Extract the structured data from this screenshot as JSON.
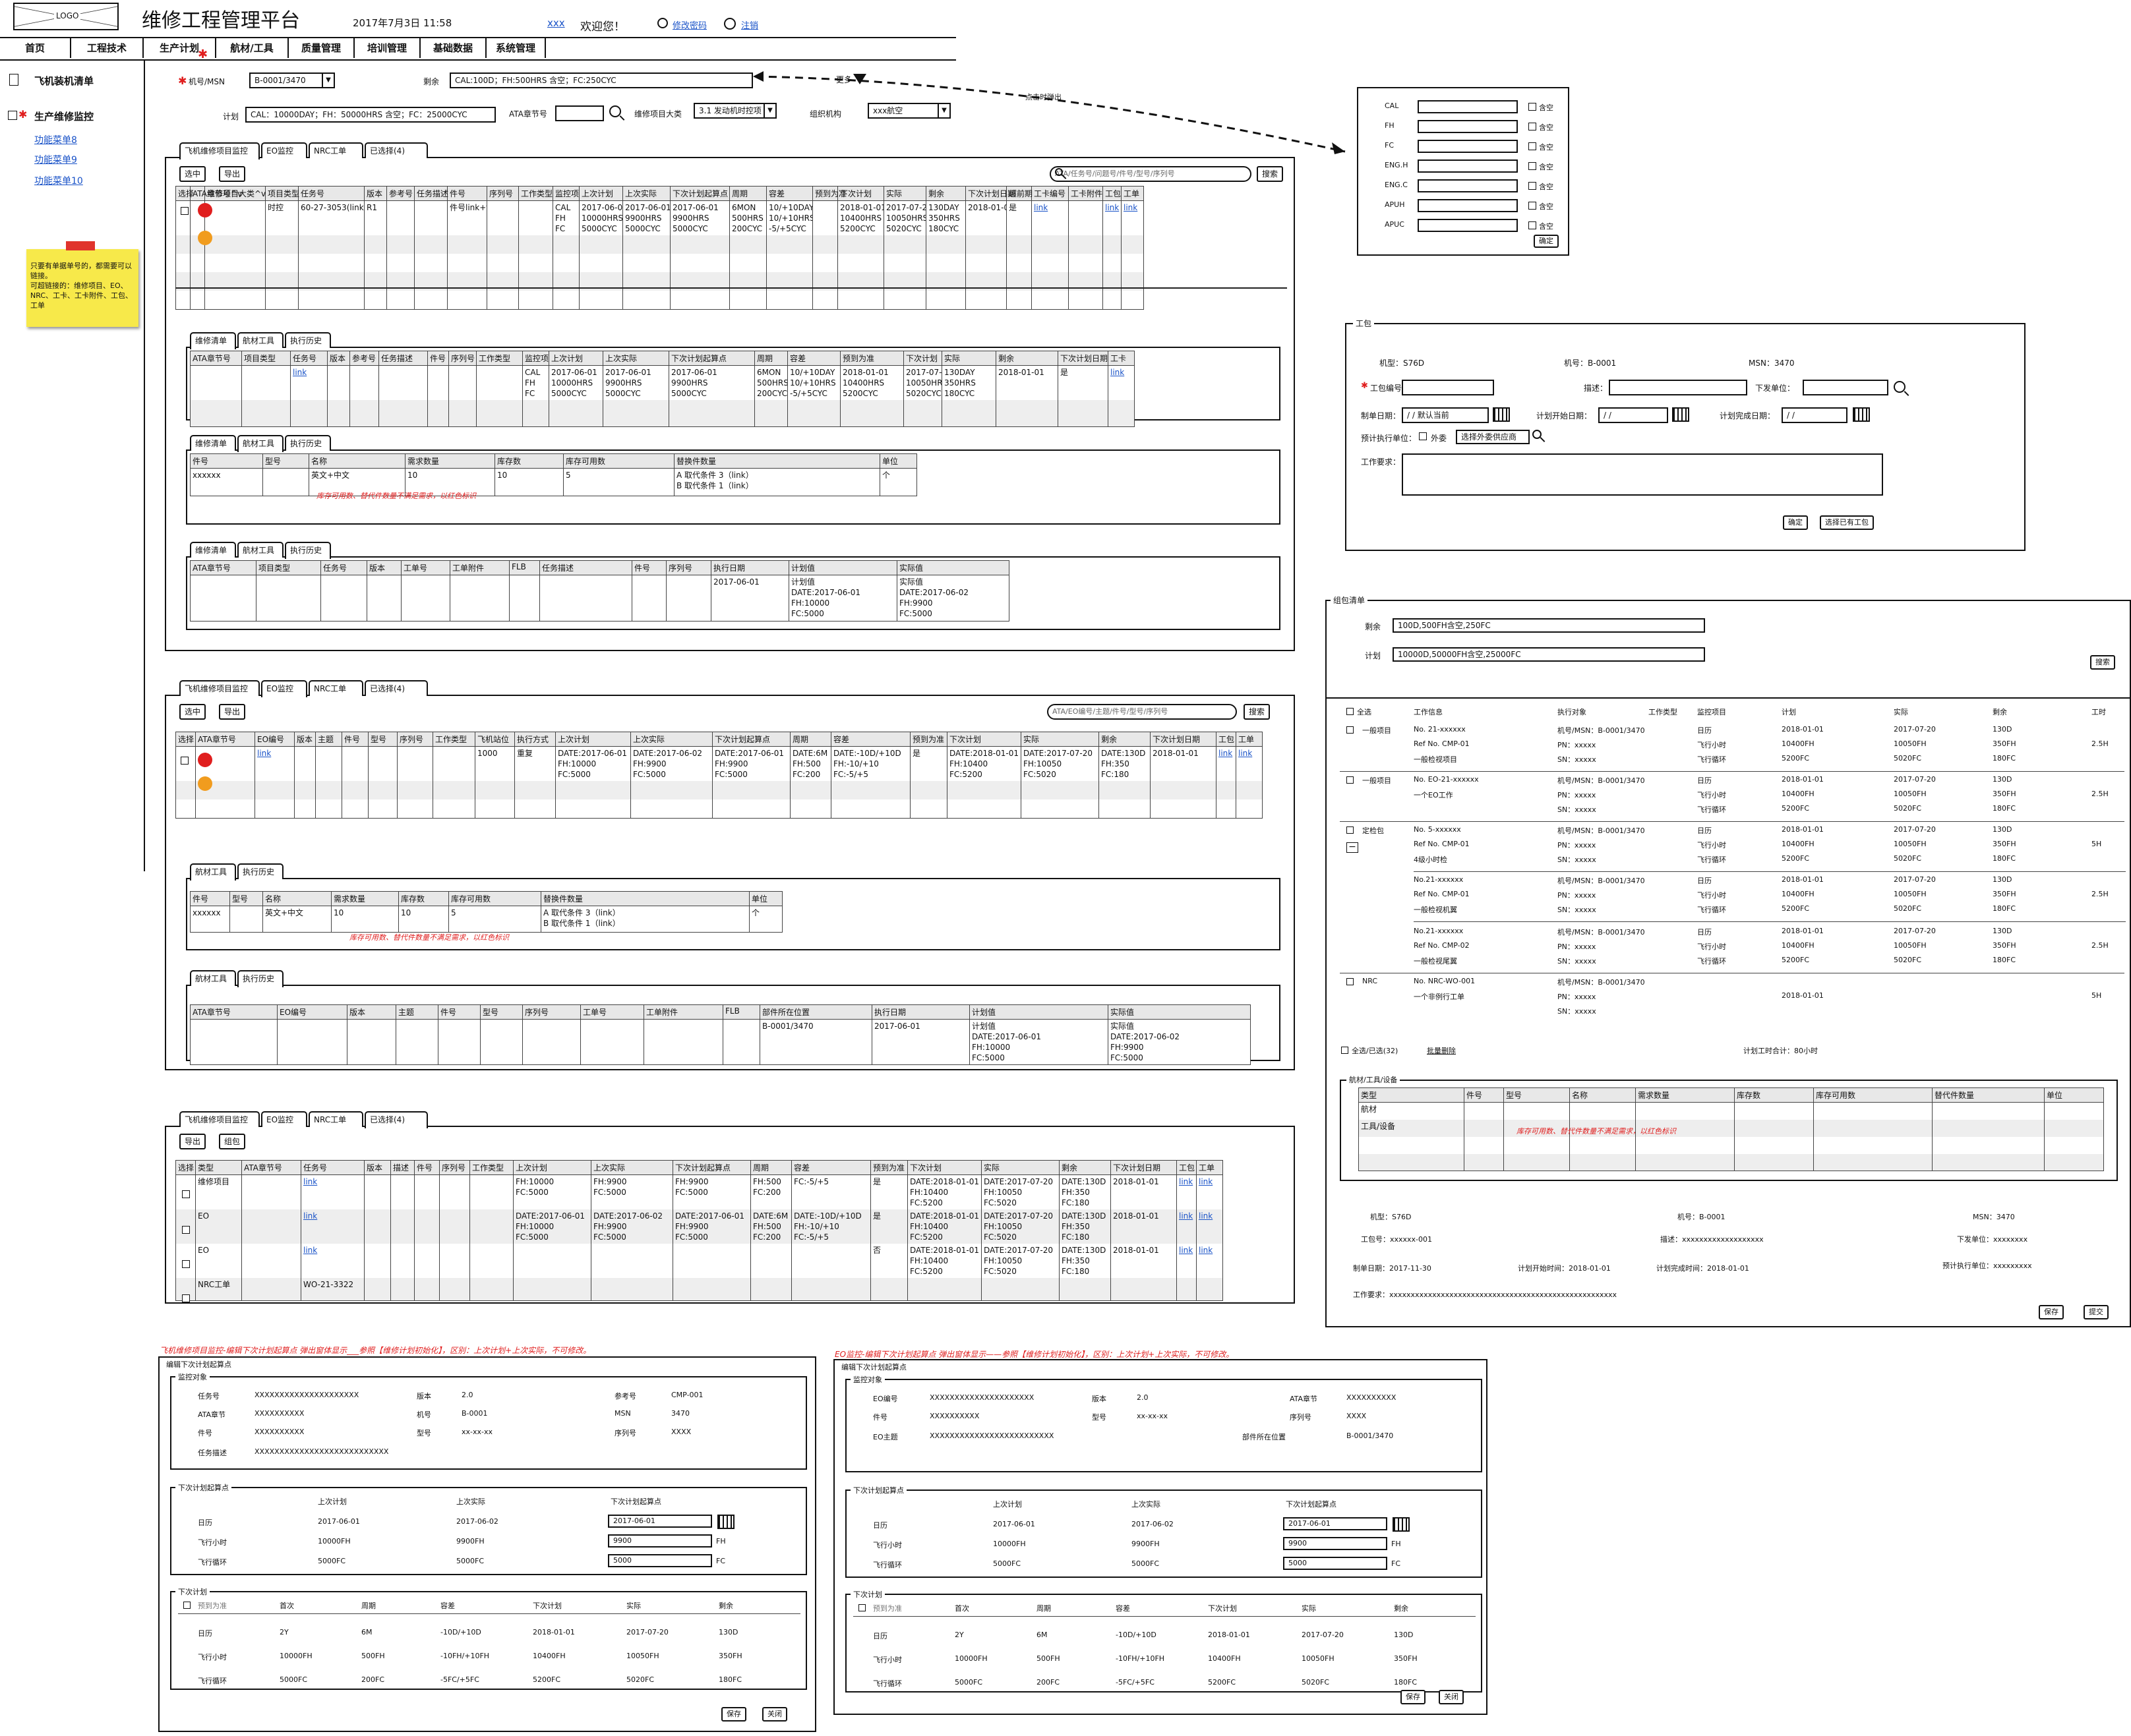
{
  "header": {
    "logo": "LOGO",
    "title": "维修工程管理平台",
    "date": "2017年7月3日 11:58",
    "user": "xxx",
    "welcome": "欢迎您！",
    "change_pwd": "修改密码",
    "logout": "注销"
  },
  "nav": [
    "首页",
    "工程技术",
    "生产计划",
    "航材/工具",
    "质量管理",
    "培训管理",
    "基础数据",
    "系统管理"
  ],
  "sidebar": {
    "item1": "飞机装机清单",
    "item2": "生产维修监控",
    "sub": [
      "功能菜单8",
      "功能菜单9",
      "功能菜单10"
    ]
  },
  "note": "只要有单据单号的，都需要可以链接。\n可超链接的：维修项目、EO、NRC、工卡、工卡附件、工包、工单",
  "filters": {
    "msn_label": "机号/MSN",
    "msn_value": "B-0001/3470",
    "remain_label": "剩余",
    "remain_value": "CAL:100D；FH:500HRS 含空；FC:250CYC",
    "more": "更多",
    "click_popup": "点击时弹出",
    "plan_label": "计划",
    "plan_value": "CAL：10000DAY；FH：50000HRS 含空；FC：25000CYC",
    "ata_label": "ATA章节号",
    "cat_label": "维修项目大类",
    "cat_value": "3.1 发动机时控项",
    "org_label": "组织机构",
    "org_value": "xxx航空"
  },
  "popup": {
    "rows": [
      {
        "label": "CAL",
        "suffix": "含空"
      },
      {
        "label": "FH",
        "suffix": "含空"
      },
      {
        "label": "FC",
        "suffix": "含空"
      },
      {
        "label": "ENG.H",
        "suffix": "含空"
      },
      {
        "label": "ENG.C",
        "suffix": "含空"
      },
      {
        "label": "APUH",
        "suffix": "含空"
      },
      {
        "label": "APUC",
        "suffix": "含空"
      }
    ],
    "ok": "确定"
  },
  "tabs1": [
    "飞机维修项目监控",
    "EO监控",
    "NRC工单",
    "已选择(4)"
  ],
  "tabs_sub_a": [
    "维修清单",
    "航材工具",
    "执行历史"
  ],
  "tabs_sub_eo": [
    "航材工具",
    "执行历史"
  ],
  "panel1": {
    "btn_select": "选中",
    "btn_export": "导出",
    "search_ph": "ATA/任务号/问题号/件号/型号/序列号",
    "search_btn": "搜索",
    "cols": [
      "选择",
      "ATA章节号^v",
      "维修项目大类^v",
      "项目类型",
      "任务号",
      "版本",
      "参考号",
      "任务描述",
      "件号",
      "序列号",
      "工作类型",
      "监控项",
      "上次计划",
      "上次实际",
      "下次计划起算点",
      "周期",
      "容差",
      "预到为准",
      "下次计划",
      "实际",
      "剩余",
      "下次计划日期",
      "超前期",
      "工卡编号",
      "工卡附件",
      "工包",
      "工单"
    ],
    "row": [
      "",
      "",
      "",
      "时控",
      "60-27-3053(link)",
      "R1",
      "",
      "",
      "件号link+title",
      "",
      "",
      "CAL\nFH\nFC",
      "2017-06-01\n10000HRS\n5000CYC",
      "2017-06-01\n9900HRS\n5000CYC",
      "2017-06-01\n9900HRS\n5000CYC",
      "6MON\n500HRS\n200CYC",
      "10/+10DAY\n10/+10HRS\n-5/+5CYC",
      "",
      "2018-01-01\n10400HRS\n5200CYC",
      "2017-07-20\n10050HRS\n5020CYC",
      "130DAY\n350HRS\n180CYC",
      "2018-01-01",
      "是",
      "link",
      "",
      "link",
      "link"
    ]
  },
  "sub1": {
    "cols": [
      "ATA章节号",
      "项目类型",
      "任务号",
      "版本",
      "参考号",
      "任务描述",
      "件号",
      "序列号",
      "工作类型",
      "监控项",
      "上次计划",
      "上次实际",
      "下次计划起算点",
      "周期",
      "容差",
      "预到为准",
      "下次计划",
      "实际",
      "剩余",
      "下次计划日期",
      "工卡"
    ],
    "row": [
      "",
      "",
      "link",
      "",
      "",
      "",
      "",
      "",
      "",
      "CAL\nFH\nFC",
      "2017-06-01\n10000HRS\n5000CYC",
      "2017-06-01\n9900HRS\n5000CYC",
      "2017-06-01\n9900HRS\n5000CYC",
      "6MON\n500HRS\n200CYC",
      "10/+10DAY\n10/+10HRS\n-5/+5CYC",
      "2018-01-01\n10400HRS\n5200CYC",
      "2017-07-20\n10050HRS\n5020CYC",
      "130DAY\n350HRS\n180CYC",
      "2018-01-01",
      "是",
      "link"
    ]
  },
  "sub2": {
    "cols": [
      "件号",
      "型号",
      "名称",
      "需求数量",
      "库存数",
      "库存可用数",
      "替换件数量",
      "单位"
    ],
    "row": [
      "xxxxxx",
      "",
      "英文+中文",
      "10",
      "10",
      "5",
      "A 取代条件 3（link）\nB 取代条件 1（link）",
      "个"
    ],
    "note": "库存可用数、替代件数量不满足需求，以红色标识"
  },
  "sub3": {
    "cols": [
      "ATA章节号",
      "项目类型",
      "任务号",
      "版本",
      "工单号",
      "工单附件",
      "FLB",
      "任务描述",
      "件号",
      "序列号",
      "执行日期",
      "计划值",
      "实际值"
    ],
    "row": [
      "",
      "",
      "",
      "",
      "",
      "",
      "",
      "",
      "",
      "",
      "2017-06-01",
      "计划值\nDATE:2017-06-01\nFH:10000\nFC:5000",
      "实际值\nDATE:2017-06-02\nFH:9900\nFC:5000"
    ]
  },
  "panel2": {
    "btn_select": "选中",
    "btn_export": "导出",
    "search_ph": "ATA/EO编号/主题/件号/型号/序列号",
    "search_btn": "搜索",
    "cols": [
      "选择",
      "ATA章节号",
      "EO编号",
      "版本",
      "主题",
      "件号",
      "型号",
      "序列号",
      "工作类型",
      "飞机站位",
      "执行方式",
      "上次计划",
      "上次实际",
      "下次计划起算点",
      "周期",
      "容差",
      "预到为准",
      "下次计划",
      "实际",
      "剩余",
      "下次计划日期",
      "工包",
      "工单"
    ],
    "row": [
      "",
      "",
      "link",
      "",
      "",
      "",
      "",
      "",
      "",
      "1000",
      "重复",
      "DATE:2017-06-01\nFH:10000\nFC:5000",
      "DATE:2017-06-02\nFH:9900\nFC:5000",
      "DATE:2017-06-01\nFH:9900\nFC:5000",
      "DATE:6M\nFH:500\nFC:200",
      "DATE:-10D/+10D\nFH:-10/+10\nFC:-5/+5",
      "是",
      "DATE:2018-01-01\nFH:10400\nFC:5200",
      "DATE:2017-07-20\nFH:10050\nFC:5020",
      "DATE:130D\nFH:350\nFC:180",
      "2018-01-01",
      "link",
      "link"
    ]
  },
  "eo_sub2": {
    "cols": [
      "件号",
      "型号",
      "名称",
      "需求数量",
      "库存数",
      "库存可用数",
      "替换件数量",
      "单位"
    ],
    "row": [
      "xxxxxx",
      "",
      "英文+中文",
      "10",
      "10",
      "5",
      "A 取代条件 3（link）\nB 取代条件 1（link）",
      "个"
    ],
    "note": "库存可用数、替代件数量不满足需求，以红色标识"
  },
  "eo_sub3": {
    "cols": [
      "ATA章节号",
      "EO编号",
      "版本",
      "主题",
      "件号",
      "型号",
      "序列号",
      "工单号",
      "工单附件",
      "FLB",
      "部件所在位置",
      "执行日期",
      "计划值",
      "实际值"
    ],
    "row": [
      "",
      "",
      "",
      "",
      "",
      "",
      "",
      "",
      "",
      "",
      "B-0001/3470",
      "2017-06-01",
      "计划值\nDATE:2017-06-01\nFH:10000\nFC:5000",
      "实际值\nDATE:2017-06-02\nFH:9900\nFC:5000"
    ]
  },
  "panel3": {
    "btn_export": "导出",
    "btn_group": "组包",
    "cols": [
      "选择",
      "类型",
      "ATA章节号",
      "任务号",
      "版本",
      "描述",
      "件号",
      "序列号",
      "工作类型",
      "上次计划",
      "上次实际",
      "下次计划起算点",
      "周期",
      "容差",
      "预到为准",
      "下次计划",
      "实际",
      "剩余",
      "下次计划日期",
      "工包",
      "工单"
    ],
    "rows": [
      [
        "",
        "维修项目",
        "",
        "link",
        "",
        "",
        "",
        "",
        "",
        "FH:10000\nFC:5000",
        "FH:9900\nFC:5000",
        "FH:9900\nFC:5000",
        "FH:500\nFC:200",
        "FC:-5/+5",
        "是",
        "DATE:2018-01-01\nFH:10400\nFC:5200",
        "DATE:2017-07-20\nFH:10050\nFC:5020",
        "DATE:130D\nFH:350\nFC:180",
        "2018-01-01",
        "link",
        "link"
      ],
      [
        "",
        "EO",
        "",
        "link",
        "",
        "",
        "",
        "",
        "",
        "DATE:2017-06-01\nFH:10000\nFC:5000",
        "DATE:2017-06-02\nFH:9900\nFC:5000",
        "DATE:2017-06-01\nFH:9900\nFC:5000",
        "DATE:6M\nFH:500\nFC:200",
        "DATE:-10D/+10D\nFH:-10/+10\nFC:-5/+5",
        "是",
        "DATE:2018-01-01\nFH:10400\nFC:5200",
        "DATE:2017-07-20\nFH:10050\nFC:5020",
        "DATE:130D\nFH:350\nFC:180",
        "2018-01-01",
        "link",
        "link"
      ],
      [
        "",
        "EO",
        "",
        "link",
        "",
        "",
        "",
        "",
        "",
        "",
        "",
        "",
        "",
        "",
        "否",
        "DATE:2018-01-01\nFH:10400\nFC:5200",
        "DATE:2017-07-20\nFH:10050\nFC:5020",
        "DATE:130D\nFH:350\nFC:180",
        "2018-01-01",
        "link",
        "link"
      ],
      [
        "",
        "NRC工单",
        "",
        "WO-21-3322",
        "",
        "",
        "",
        "",
        "",
        "",
        "",
        "",
        "",
        "",
        "",
        "",
        "",
        "",
        "",
        "",
        ""
      ]
    ]
  },
  "workpack": {
    "title": "工包",
    "model": "机型：S76D",
    "reg": "机号：B-0001",
    "msn": "MSN：3470",
    "wp_no": "工包编号：",
    "desc": "描述：",
    "unit": "下发单位：",
    "plan_date": "制单日期：",
    "plan_date_val": "/ /  默认当前",
    "start": "计划开始日期：",
    "start_val": "/ /",
    "end": "计划完成日期：",
    "end_val": "/ /",
    "exec_unit": "预计执行单位：",
    "outsource": "外委",
    "select_vendor": "选择外委供应商",
    "req": "工作要求：",
    "confirm": "确定",
    "choose_existing": "选择已有工包"
  },
  "group": {
    "title": "组包清单",
    "remain_label": "剩余",
    "remain_val": "100D,500FH含空,250FC",
    "plan_label": "计划",
    "plan_val": "10000D,50000FH含空,25000FC",
    "search": "搜索",
    "cols": [
      "全选",
      "工作信息",
      "执行对象",
      "工作类型",
      "监控项目",
      "计划",
      "实际",
      "剩余",
      "工时"
    ],
    "items": [
      {
        "type": "一般项目",
        "info": [
          "No. 21-xxxxxx",
          "Ref No. CMP-01",
          "一般检视项目"
        ],
        "obj": [
          "机号/MSN：B-0001/3470",
          "PN：xxxxx",
          "SN：xxxxx"
        ],
        "mon": [
          "日历",
          "飞行小时",
          "飞行循环"
        ],
        "plan": [
          "2018-01-01",
          "10400FH",
          "5200FC"
        ],
        "act": [
          "2017-07-20",
          "10050FH",
          "5020FC"
        ],
        "rem": [
          "130D",
          "350FH",
          "180FC"
        ],
        "hrs": "2.5H"
      },
      {
        "type": "一般项目",
        "info": [
          "No. EO-21-xxxxxx",
          "一个EO工作",
          ""
        ],
        "obj": [
          "机号/MSN：B-0001/3470",
          "PN：xxxxx",
          "SN：xxxxx"
        ],
        "mon": [
          "日历",
          "飞行小时",
          "飞行循环"
        ],
        "plan": [
          "2018-01-01",
          "10400FH",
          "5200FC"
        ],
        "act": [
          "2017-07-20",
          "10050FH",
          "5020FC"
        ],
        "rem": [
          "130D",
          "350FH",
          "180FC"
        ],
        "hrs": "2.5H"
      },
      {
        "type": "定检包",
        "info": [
          "No. 5-xxxxxx",
          "Ref No. CMP-01",
          "4级小时检"
        ],
        "obj": [
          "机号/MSN：B-0001/3470",
          "PN：xxxxx",
          "SN：xxxxx"
        ],
        "mon": [
          "日历",
          "飞行小时",
          "飞行循环"
        ],
        "plan": [
          "2018-01-01",
          "10400FH",
          "5200FC"
        ],
        "act": [
          "2017-07-20",
          "10050FH",
          "5020FC"
        ],
        "rem": [
          "130D",
          "350FH",
          "180FC"
        ],
        "hrs": "5H"
      },
      {
        "type": "",
        "info": [
          "No.21-xxxxxx",
          "Ref No. CMP-01",
          "一般检视机翼"
        ],
        "obj": [
          "机号/MSN：B-0001/3470",
          "PN：xxxxx",
          "SN：xxxxx"
        ],
        "mon": [
          "日历",
          "飞行小时",
          "飞行循环"
        ],
        "plan": [
          "2018-01-01",
          "10400FH",
          "5200FC"
        ],
        "act": [
          "2017-07-20",
          "10050FH",
          "5020FC"
        ],
        "rem": [
          "130D",
          "350FH",
          "180FC"
        ],
        "hrs": "2.5H"
      },
      {
        "type": "",
        "info": [
          "No.21-xxxxxx",
          "Ref No. CMP-02",
          "一般检视尾翼"
        ],
        "obj": [
          "机号/MSN：B-0001/3470",
          "PN：xxxxx",
          "SN：xxxxx"
        ],
        "mon": [
          "日历",
          "飞行小时",
          "飞行循环"
        ],
        "plan": [
          "2018-01-01",
          "10400FH",
          "5200FC"
        ],
        "act": [
          "2017-07-20",
          "10050FH",
          "5020FC"
        ],
        "rem": [
          "130D",
          "350FH",
          "180FC"
        ],
        "hrs": "2.5H"
      },
      {
        "type": "NRC",
        "info": [
          "No. NRC-WO-001",
          "一个非例行工单",
          ""
        ],
        "obj": [
          "机号/MSN：B-0001/3470",
          "PN：xxxxx",
          "SN：xxxxx"
        ],
        "mon": [
          "",
          "",
          ""
        ],
        "plan": [
          "",
          "2018-01-01",
          ""
        ],
        "act": [
          "",
          "",
          ""
        ],
        "rem": [
          "",
          "",
          ""
        ],
        "hrs": "5H"
      }
    ],
    "selected": "全选/已选(32)",
    "batch_delete": "批量删除",
    "plan_hours": "计划工时合计：80小时",
    "material_title": "航材/工具/设备",
    "mat_cols": [
      "类型",
      "件号",
      "型号",
      "名称",
      "需求数量",
      "库存数",
      "库存可用数",
      "替代件数量",
      "单位"
    ],
    "mat_rows": [
      "航材",
      "工具/设备"
    ],
    "mat_note": "库存可用数、替代件数量不满足需求，以红色标识",
    "f_model": "机型：S76D",
    "f_reg": "机号：B-0001",
    "f_msn": "MSN：3470",
    "f_wp": "工包号：xxxxxx-001",
    "f_desc": "描述：xxxxxxxxxxxxxxxxxxx",
    "f_unit": "下发单位：xxxxxxxx",
    "f_date": "制单日期：2017-11-30",
    "f_start": "计划开始时间：2018-01-01",
    "f_end": "计划完成时间：2018-01-01",
    "f_exec": "预计执行单位：xxxxxxxxx",
    "f_req": "工作要求：xxxxxxxxxxxxxxxxxxxxxxxxxxxxxxxxxxxxxxxxxxxxxxxxxxxxx",
    "save": "保存",
    "submit": "提交"
  },
  "dlg1": {
    "note": "飞机维修项目监控-编辑下次计划起算点 弹出窗体显示___参照【维修计划初始化】，区别：上次计划+上次实际，不可修改。",
    "title": "编辑下次计划起算点",
    "mon_title": "监控对象",
    "f": [
      [
        "任务号",
        "XXXXXXXXXXXXXXXXXXXXX"
      ],
      [
        "版本",
        "2.0"
      ],
      [
        "参考号",
        "CMP-001"
      ],
      [
        "ATA章节",
        "XXXXXXXXXX"
      ],
      [
        "机号",
        "B-0001"
      ],
      [
        "MSN",
        "3470"
      ],
      [
        "件号",
        "XXXXXXXXXX"
      ],
      [
        "型号",
        "xx-xx-xx"
      ],
      [
        "序列号",
        "XXXX"
      ],
      [
        "任务描述",
        "XXXXXXXXXXXXXXXXXXXXXXXXXXX"
      ]
    ],
    "next_title": "下次计划起算点",
    "h": [
      "上次计划",
      "上次实际",
      "下次计划起算点"
    ],
    "rows": [
      [
        "日历",
        "2017-06-01",
        "2017-06-02",
        "2017-06-01",
        ""
      ],
      [
        "飞行小时",
        "10000FH",
        "9900FH",
        "9900",
        "FH"
      ],
      [
        "飞行循环",
        "5000FC",
        "5000FC",
        "5000",
        "FC"
      ]
    ],
    "plan_title": "下次计划",
    "ph": [
      "预到为准",
      "首次",
      "周期",
      "容差",
      "下次计划",
      "实际",
      "剩余"
    ],
    "prow": [
      [
        "日历",
        "2Y",
        "6M",
        "-10D/+10D",
        "2018-01-01",
        "2017-07-20",
        "130D"
      ],
      [
        "飞行小时",
        "10000FH",
        "500FH",
        "-10FH/+10FH",
        "10400FH",
        "10050FH",
        "350FH"
      ],
      [
        "飞行循环",
        "5000FC",
        "200FC",
        "-5FC/+5FC",
        "5200FC",
        "5020FC",
        "180FC"
      ]
    ],
    "save": "保存",
    "close": "关闭"
  },
  "dlg2": {
    "note": "EO监控-编辑下次计划起算点 弹出窗体显示——参照【维修计划初始化】，区别：上次计划+上次实际，不可修改。",
    "title": "编辑下次计划起算点",
    "mon_title": "监控对象",
    "f": [
      [
        "EO编号",
        "XXXXXXXXXXXXXXXXXXXXX"
      ],
      [
        "版本",
        "2.0"
      ],
      [
        "ATA章节",
        "XXXXXXXXXX"
      ],
      [
        "件号",
        "XXXXXXXXXX"
      ],
      [
        "型号",
        "xx-xx-xx"
      ],
      [
        "序列号",
        "XXXX"
      ],
      [
        "EO主题",
        "XXXXXXXXXXXXXXXXXXXXXXXXX"
      ],
      [
        "部件所在位置",
        "B-0001/3470"
      ]
    ],
    "next_title": "下次计划起算点",
    "h": [
      "上次计划",
      "上次实际",
      "下次计划起算点"
    ],
    "rows": [
      [
        "日历",
        "2017-06-01",
        "2017-06-02",
        "2017-06-01",
        ""
      ],
      [
        "飞行小时",
        "10000FH",
        "9900FH",
        "9900",
        "FH"
      ],
      [
        "飞行循环",
        "5000FC",
        "5000FC",
        "5000",
        "FC"
      ]
    ],
    "plan_title": "下次计划",
    "ph": [
      "预到为准",
      "首次",
      "周期",
      "容差",
      "下次计划",
      "实际",
      "剩余"
    ],
    "prow": [
      [
        "日历",
        "2Y",
        "6M",
        "-10D/+10D",
        "2018-01-01",
        "2017-07-20",
        "130D"
      ],
      [
        "飞行小时",
        "10000FH",
        "500FH",
        "-10FH/+10FH",
        "10400FH",
        "10050FH",
        "350FH"
      ],
      [
        "飞行循环",
        "5000FC",
        "200FC",
        "-5FC/+5FC",
        "5200FC",
        "5020FC",
        "180FC"
      ]
    ],
    "save": "保存",
    "close": "关闭"
  }
}
